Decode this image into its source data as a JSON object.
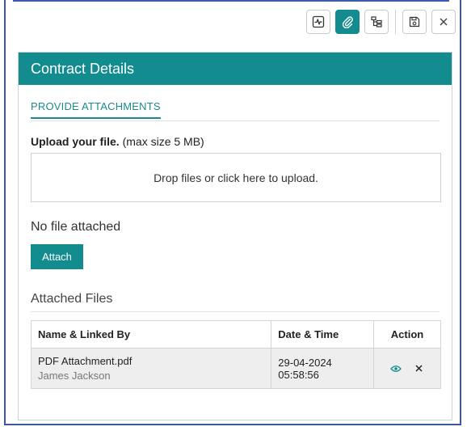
{
  "card": {
    "title": "Contract Details",
    "section_tab": "PROVIDE ATTACHMENTS",
    "upload_label_bold": "Upload your file.",
    "upload_label_hint": "(max size 5 MB)",
    "dropzone_text": "Drop files or click here to upload.",
    "no_file_text": "No file attached",
    "attach_button": "Attach",
    "attached_files_title": "Attached Files"
  },
  "toolbar": {
    "icons": [
      "activity-icon",
      "paperclip-icon",
      "tree-icon",
      "save-icon",
      "close-icon"
    ],
    "active": "paperclip-icon"
  },
  "files_table": {
    "headers": [
      "Name & Linked By",
      "Date & Time",
      "Action"
    ],
    "rows": [
      {
        "name": "PDF Attachment.pdf",
        "linked_by": "James Jackson",
        "date": "29-04-2024",
        "time": "05:58:56"
      }
    ]
  },
  "colors": {
    "accent": "#138c8f",
    "frame": "#3a57a8"
  }
}
